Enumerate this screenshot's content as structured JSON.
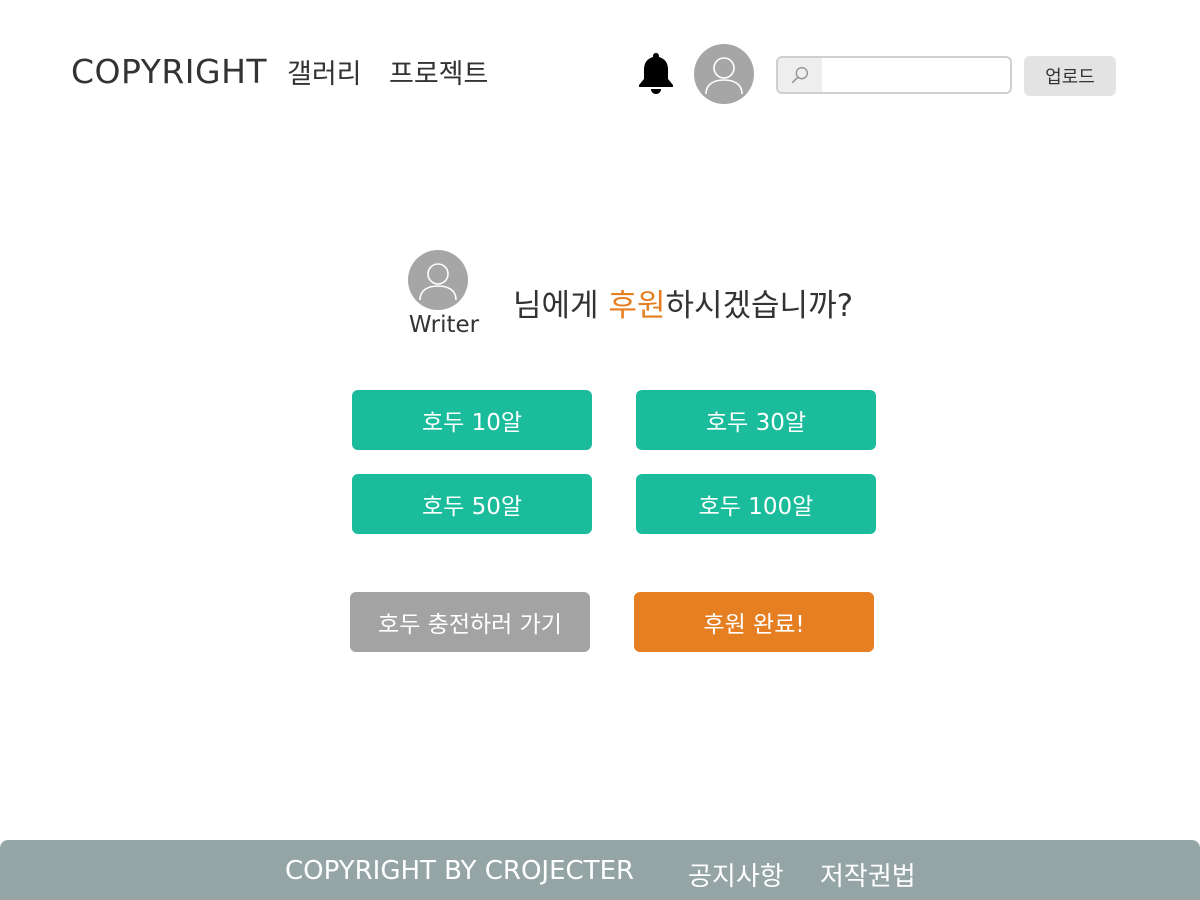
{
  "header": {
    "logo": "COPYRIGHT",
    "nav": {
      "gallery": "갤러리",
      "project": "프로젝트"
    },
    "search": {
      "placeholder": "",
      "value": ""
    },
    "upload_label": "업로드"
  },
  "icons": {
    "bell": "bell-icon",
    "avatar": "user-avatar-icon",
    "search": "search-icon"
  },
  "main": {
    "writer_name": "Writer",
    "question": {
      "before": "님에게 ",
      "highlight": "후원",
      "after": "하시겠습니까?"
    },
    "options": [
      {
        "label": "호두 10알",
        "amount": 10
      },
      {
        "label": "호두 30알",
        "amount": 30
      },
      {
        "label": "호두 50알",
        "amount": 50
      },
      {
        "label": "호두 100알",
        "amount": 100
      }
    ],
    "charge_label": "호두 충전하러 가기",
    "complete_label": "후원 완료!"
  },
  "footer": {
    "copyright": "COPYRIGHT BY CROJECTER",
    "notice": "공지사항",
    "law": "저작권법"
  },
  "colors": {
    "accent_green": "#1abc9c",
    "accent_orange": "#e67e22",
    "button_gray": "#a3a3a3",
    "footer_bg": "#95a5a6",
    "avatar_bg": "#a6a6a6"
  }
}
